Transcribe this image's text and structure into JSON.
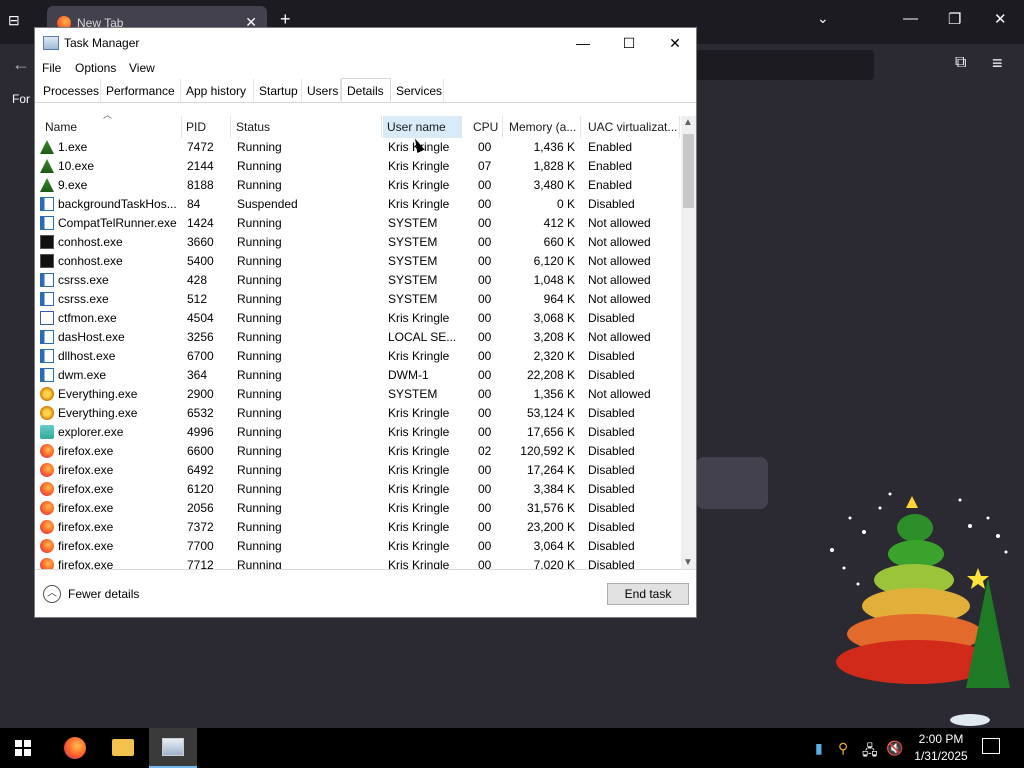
{
  "browser": {
    "tab_title": "New Tab",
    "bookmark_text": "For"
  },
  "task_manager": {
    "title": "Task Manager",
    "menu": [
      "File",
      "Options",
      "View"
    ],
    "tabs": [
      "Processes",
      "Performance",
      "App history",
      "Startup",
      "Users",
      "Details",
      "Services"
    ],
    "active_tab": "Details",
    "columns": [
      "Name",
      "PID",
      "Status",
      "User name",
      "CPU",
      "Memory (a...",
      "UAC virtualizat..."
    ],
    "sorted_column": "User name",
    "rows": [
      {
        "icon": "tree-icon",
        "name": "1.exe",
        "pid": "7472",
        "status": "Running",
        "user": "Kris Kringle",
        "cpu": "00",
        "memory": "1,436 K",
        "uac": "Enabled"
      },
      {
        "icon": "tree-icon",
        "name": "10.exe",
        "pid": "2144",
        "status": "Running",
        "user": "Kris Kringle",
        "cpu": "07",
        "memory": "1,828 K",
        "uac": "Enabled"
      },
      {
        "icon": "tree-icon",
        "name": "9.exe",
        "pid": "8188",
        "status": "Running",
        "user": "Kris Kringle",
        "cpu": "00",
        "memory": "3,480 K",
        "uac": "Enabled"
      },
      {
        "icon": "app-icon",
        "name": "backgroundTaskHos...",
        "pid": "84",
        "status": "Suspended",
        "user": "Kris Kringle",
        "cpu": "00",
        "memory": "0 K",
        "uac": "Disabled"
      },
      {
        "icon": "app-icon",
        "name": "CompatTelRunner.exe",
        "pid": "1424",
        "status": "Running",
        "user": "SYSTEM",
        "cpu": "00",
        "memory": "412 K",
        "uac": "Not allowed"
      },
      {
        "icon": "console-icon",
        "name": "conhost.exe",
        "pid": "3660",
        "status": "Running",
        "user": "SYSTEM",
        "cpu": "00",
        "memory": "660 K",
        "uac": "Not allowed"
      },
      {
        "icon": "console-icon",
        "name": "conhost.exe",
        "pid": "5400",
        "status": "Running",
        "user": "SYSTEM",
        "cpu": "00",
        "memory": "6,120 K",
        "uac": "Not allowed"
      },
      {
        "icon": "app-icon",
        "name": "csrss.exe",
        "pid": "428",
        "status": "Running",
        "user": "SYSTEM",
        "cpu": "00",
        "memory": "1,048 K",
        "uac": "Not allowed"
      },
      {
        "icon": "app-icon",
        "name": "csrss.exe",
        "pid": "512",
        "status": "Running",
        "user": "SYSTEM",
        "cpu": "00",
        "memory": "964 K",
        "uac": "Not allowed"
      },
      {
        "icon": "pen-icon",
        "name": "ctfmon.exe",
        "pid": "4504",
        "status": "Running",
        "user": "Kris Kringle",
        "cpu": "00",
        "memory": "3,068 K",
        "uac": "Disabled"
      },
      {
        "icon": "app-icon",
        "name": "dasHost.exe",
        "pid": "3256",
        "status": "Running",
        "user": "LOCAL SE...",
        "cpu": "00",
        "memory": "3,208 K",
        "uac": "Not allowed"
      },
      {
        "icon": "app-icon",
        "name": "dllhost.exe",
        "pid": "6700",
        "status": "Running",
        "user": "Kris Kringle",
        "cpu": "00",
        "memory": "2,320 K",
        "uac": "Disabled"
      },
      {
        "icon": "app-icon",
        "name": "dwm.exe",
        "pid": "364",
        "status": "Running",
        "user": "DWM-1",
        "cpu": "00",
        "memory": "22,208 K",
        "uac": "Disabled"
      },
      {
        "icon": "key-icon",
        "name": "Everything.exe",
        "pid": "2900",
        "status": "Running",
        "user": "SYSTEM",
        "cpu": "00",
        "memory": "1,356 K",
        "uac": "Not allowed"
      },
      {
        "icon": "key-icon",
        "name": "Everything.exe",
        "pid": "6532",
        "status": "Running",
        "user": "Kris Kringle",
        "cpu": "00",
        "memory": "53,124 K",
        "uac": "Disabled"
      },
      {
        "icon": "folder-icon",
        "name": "explorer.exe",
        "pid": "4996",
        "status": "Running",
        "user": "Kris Kringle",
        "cpu": "00",
        "memory": "17,656 K",
        "uac": "Disabled"
      },
      {
        "icon": "firefox-icon",
        "name": "firefox.exe",
        "pid": "6600",
        "status": "Running",
        "user": "Kris Kringle",
        "cpu": "02",
        "memory": "120,592 K",
        "uac": "Disabled"
      },
      {
        "icon": "firefox-icon",
        "name": "firefox.exe",
        "pid": "6492",
        "status": "Running",
        "user": "Kris Kringle",
        "cpu": "00",
        "memory": "17,264 K",
        "uac": "Disabled"
      },
      {
        "icon": "firefox-icon",
        "name": "firefox.exe",
        "pid": "6120",
        "status": "Running",
        "user": "Kris Kringle",
        "cpu": "00",
        "memory": "3,384 K",
        "uac": "Disabled"
      },
      {
        "icon": "firefox-icon",
        "name": "firefox.exe",
        "pid": "2056",
        "status": "Running",
        "user": "Kris Kringle",
        "cpu": "00",
        "memory": "31,576 K",
        "uac": "Disabled"
      },
      {
        "icon": "firefox-icon",
        "name": "firefox.exe",
        "pid": "7372",
        "status": "Running",
        "user": "Kris Kringle",
        "cpu": "00",
        "memory": "23,200 K",
        "uac": "Disabled"
      },
      {
        "icon": "firefox-icon",
        "name": "firefox.exe",
        "pid": "7700",
        "status": "Running",
        "user": "Kris Kringle",
        "cpu": "00",
        "memory": "3,064 K",
        "uac": "Disabled"
      },
      {
        "icon": "firefox-icon",
        "name": "firefox.exe",
        "pid": "7712",
        "status": "Running",
        "user": "Kris Kringle",
        "cpu": "00",
        "memory": "7,020 K",
        "uac": "Disabled"
      }
    ],
    "fewer_details": "Fewer details",
    "end_task": "End task"
  },
  "taskbar": {
    "time": "2:00 PM",
    "date": "1/31/2025"
  },
  "colors": {
    "selected_header": "#d9ebf9",
    "taskbar_bg": "#000000",
    "active_task_accent": "#76b9ed"
  }
}
